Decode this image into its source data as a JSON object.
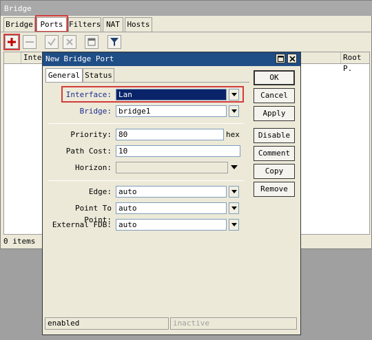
{
  "bridge_window": {
    "title": "Bridge",
    "tabs": [
      "Bridge",
      "Ports",
      "Filters",
      "NAT",
      "Hosts"
    ],
    "active_tab": "Ports",
    "toolbar_icons": [
      "add-icon",
      "remove-icon",
      "enable-icon",
      "disable-icon",
      "comment-icon",
      "filter-icon"
    ],
    "columns": [
      "Inter",
      "Root P."
    ],
    "items_count": "0 items"
  },
  "dialog": {
    "title": "New Bridge Port",
    "tabs": [
      "General",
      "Status"
    ],
    "active_tab": "General",
    "fields": {
      "interface": {
        "label": "Interface:",
        "value": "Lan"
      },
      "bridge": {
        "label": "Bridge:",
        "value": "bridge1"
      },
      "priority": {
        "label": "Priority:",
        "value": "80",
        "suffix": "hex"
      },
      "path_cost": {
        "label": "Path Cost:",
        "value": "10"
      },
      "horizon": {
        "label": "Horizon:",
        "value": ""
      },
      "edge": {
        "label": "Edge:",
        "value": "auto"
      },
      "point_to_point": {
        "label": "Point To Point:",
        "value": "auto"
      },
      "external_fdb": {
        "label": "External FDB:",
        "value": "auto"
      }
    },
    "buttons": {
      "ok": "OK",
      "cancel": "Cancel",
      "apply": "Apply",
      "disable": "Disable",
      "comment": "Comment",
      "copy": "Copy",
      "remove": "Remove"
    },
    "status": {
      "left": "enabled",
      "right": "inactive"
    }
  },
  "colors": {
    "highlight": "#d43a3a",
    "titlebar": "#1f4d85",
    "selection": "#0a246a"
  }
}
